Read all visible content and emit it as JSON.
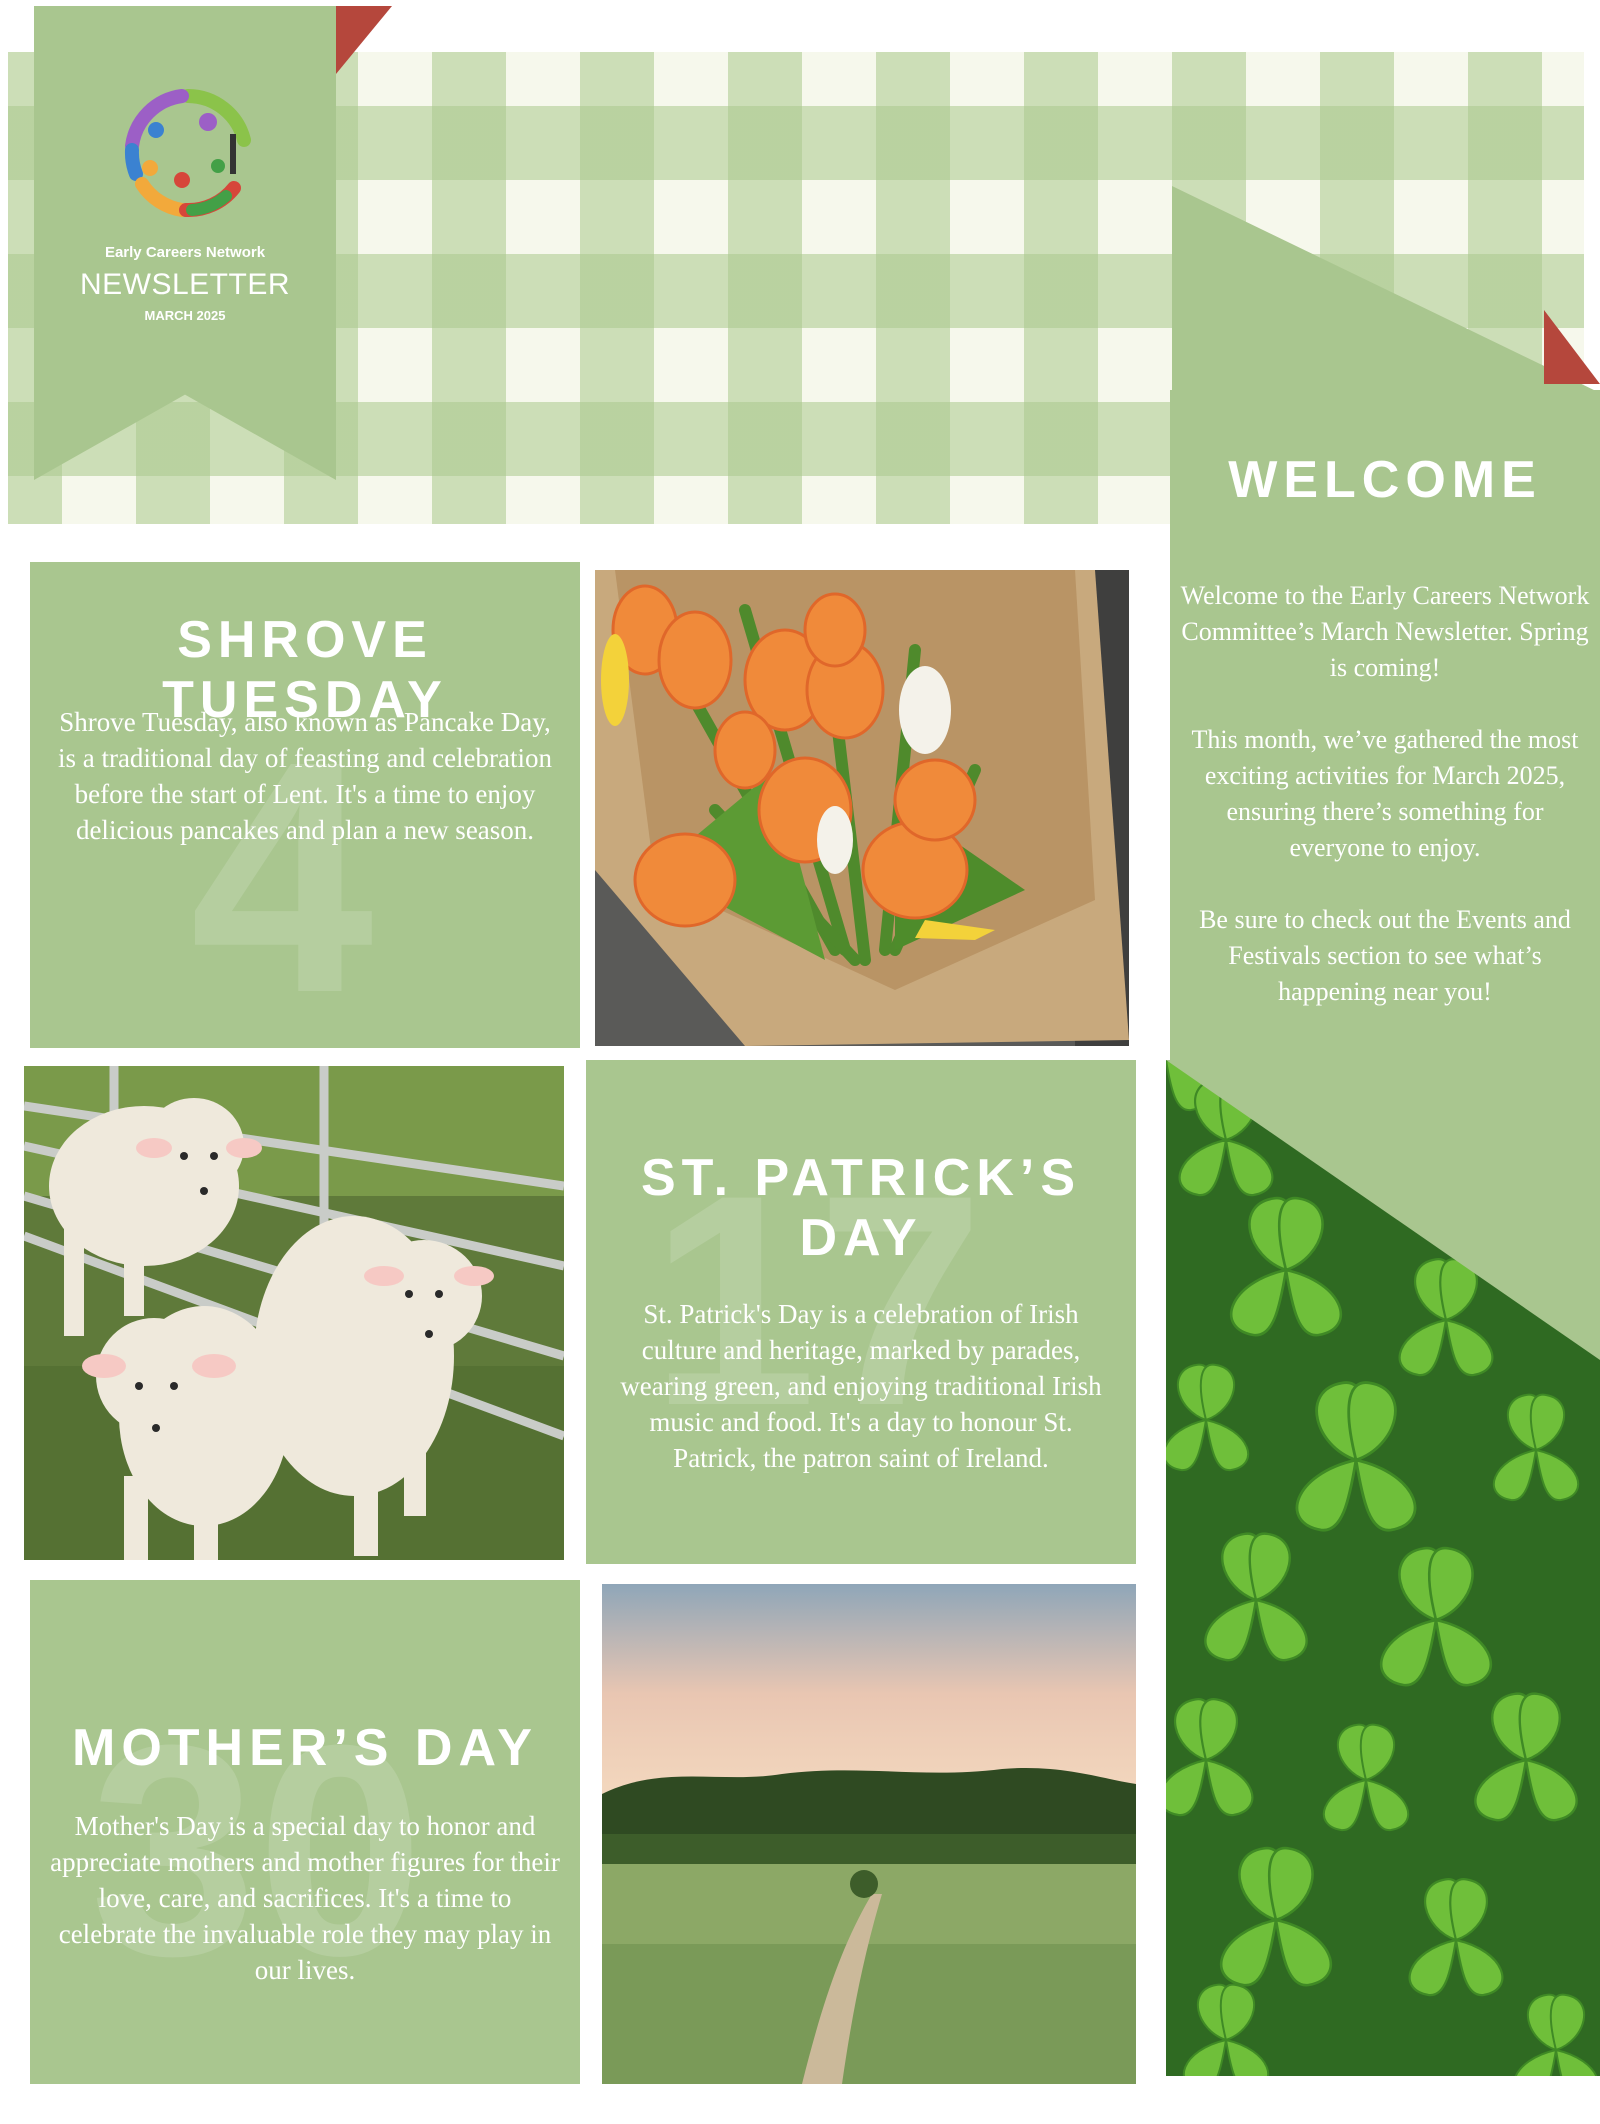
{
  "masthead": {
    "network": "Early Careers Network",
    "title": "NEWSLETTER",
    "date": "MARCH 2025",
    "logo_icon": "people-circle-logo-icon"
  },
  "welcome": {
    "heading": "WELCOME",
    "paragraph_1": "Welcome to the Early Careers Network Committee’s March Newsletter. Spring is coming!",
    "paragraph_2": "This month, we’ve gathered the most exciting activities for March 2025, ensuring there’s something for everyone to enjoy.",
    "paragraph_3": "Be sure to check out the Events and Festivals section to see what’s happening near you!"
  },
  "shrove": {
    "number": "4",
    "heading": "SHROVE TUESDAY",
    "body": "Shrove Tuesday, also known as Pancake Day, is a traditional day of feasting and celebration before the start of Lent. It's a time to enjoy delicious pancakes and plan a new season."
  },
  "patrick": {
    "number": "17",
    "heading_line1": "ST. PATRICK’S",
    "heading_line2": "DAY",
    "body": "St. Patrick's Day is a celebration of Irish culture and heritage, marked by parades, wearing green, and enjoying traditional Irish music and food. It's a day to honour St. Patrick, the patron saint of Ireland."
  },
  "mothers": {
    "number": "30",
    "heading": "MOTHER’S DAY",
    "body": "Mother's Day is a special day to honor and appreciate mothers and mother figures for their love, care, and sacrifices. It's a time to celebrate the invaluable role they may play in our lives."
  },
  "images": [
    "tulip-bouquet-photo",
    "lambs-photo",
    "shamrock-clovers-photo",
    "meadow-sunset-photo"
  ],
  "colors": {
    "panel": "#a9c68f",
    "accent_fold": "#b5473c",
    "gingham_light": "#f6f8ec"
  }
}
